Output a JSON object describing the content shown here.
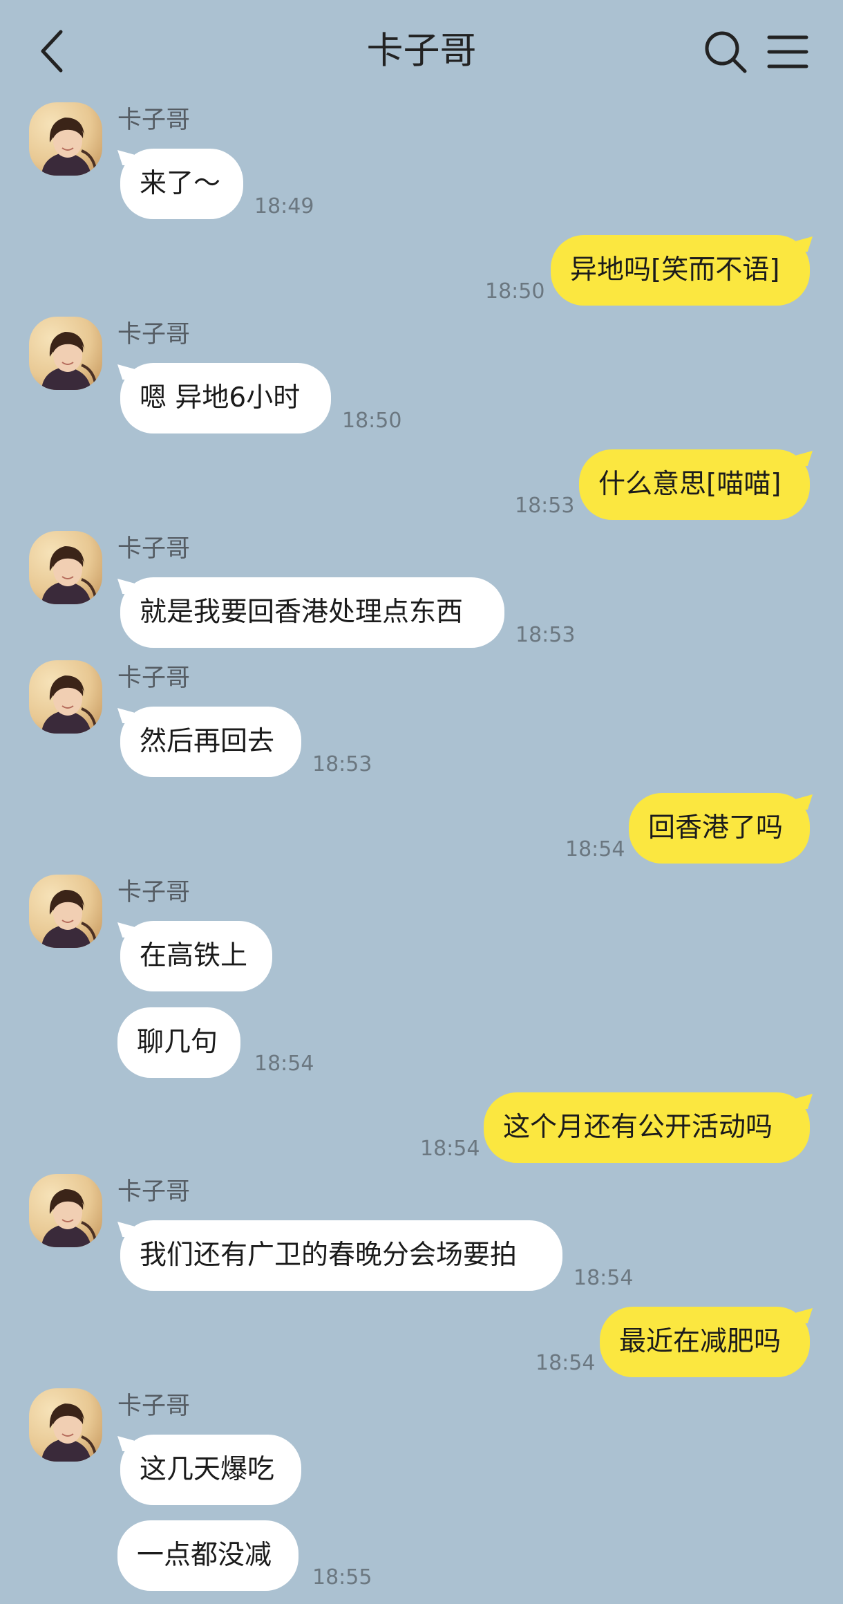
{
  "header": {
    "title": "卡子哥"
  },
  "contact": {
    "name": "卡子哥"
  },
  "messages": [
    {
      "text": "来了～",
      "time": "18:49"
    },
    {
      "text": "异地吗[笑而不语]",
      "time": "18:50"
    },
    {
      "text": "嗯 异地6小时",
      "time": "18:50"
    },
    {
      "text": "什么意思[喵喵]",
      "time": "18:53"
    },
    {
      "text": "就是我要回香港处理点东西",
      "time": "18:53"
    },
    {
      "text": "然后再回去",
      "time": "18:53"
    },
    {
      "text": "回香港了吗",
      "time": "18:54"
    },
    {
      "text": "在高铁上"
    },
    {
      "text": "聊几句",
      "time": "18:54"
    },
    {
      "text": "这个月还有公开活动吗",
      "time": "18:54"
    },
    {
      "text": "我们还有广卫的春晚分会场要拍",
      "time": "18:54"
    },
    {
      "text": "最近在减肥吗",
      "time": "18:54"
    },
    {
      "text": "这几天爆吃"
    },
    {
      "text": "一点都没减",
      "time": "18:55"
    }
  ],
  "colors": {
    "background": "#abc1d1",
    "outgoing_bubble": "#fbe740",
    "incoming_bubble": "#ffffff"
  },
  "icons": [
    "back-arrow-icon",
    "search-icon",
    "menu-icon"
  ]
}
